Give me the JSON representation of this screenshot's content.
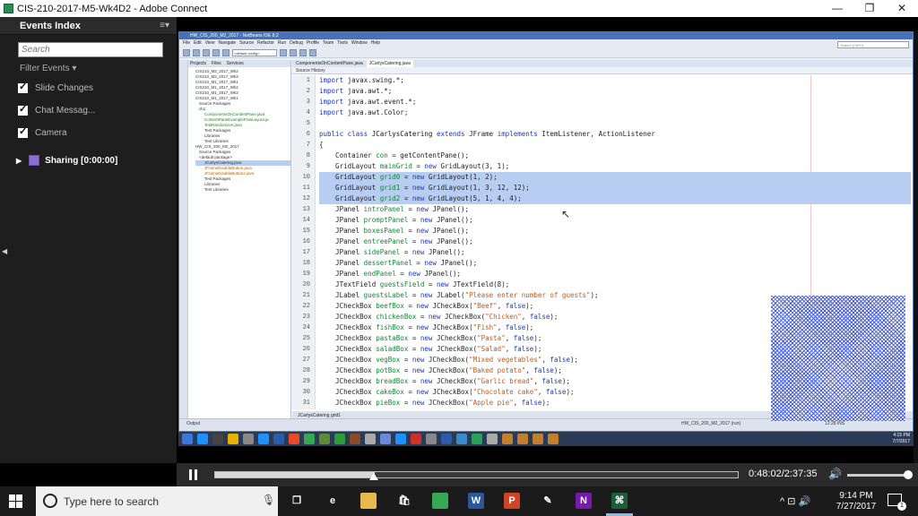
{
  "window": {
    "title": "CIS-210-2017-M5-Wk4D2 - Adobe Connect",
    "controls": [
      "—",
      "❐",
      "✕"
    ]
  },
  "sidebar": {
    "title": "Events Index",
    "menu_glyph": "≡▾",
    "search_placeholder": "Search",
    "filter_label": "Filter Events ▾",
    "items": [
      {
        "label": "Slide Changes"
      },
      {
        "label": "Chat Messag..."
      },
      {
        "label": "Camera"
      }
    ],
    "sharing_label": "Sharing [0:00:00]"
  },
  "netbeans": {
    "title": "HW_CIS_200_M2_2017 - NetBeans IDE 8.2",
    "menus": [
      "File",
      "Edit",
      "View",
      "Navigate",
      "Source",
      "Refactor",
      "Run",
      "Debug",
      "Profile",
      "Team",
      "Tools",
      "Window",
      "Help"
    ],
    "config": "<default config>",
    "search_placeholder": "Search (Ctrl+I)",
    "project_tabs": [
      "Projects",
      "Files",
      "Services"
    ],
    "tree": [
      {
        "text": "CIS210_M2_2017_Wk2",
        "cls": ""
      },
      {
        "text": "CIS210_M2_2017_Wk3",
        "cls": ""
      },
      {
        "text": "CIS210_M1_2017_Wk1",
        "cls": ""
      },
      {
        "text": "CIS210_M1_2017_Wk2",
        "cls": ""
      },
      {
        "text": "CIS210_M1_2017_Wk3",
        "cls": ""
      },
      {
        "text": "CIS210_M1_2017_Wk1",
        "cls": ""
      },
      {
        "text": "Source Packages",
        "cls": ""
      },
      {
        "text": "ch1",
        "cls": ""
      },
      {
        "text": "ComponentsOnContentPane.java",
        "cls": "g"
      },
      {
        "text": "ContentPaneExampleFlowLayout.ja",
        "cls": "g"
      },
      {
        "text": "TestRandomizer.java",
        "cls": "g"
      },
      {
        "text": "Test Packages",
        "cls": ""
      },
      {
        "text": "Libraries",
        "cls": ""
      },
      {
        "text": "Test Libraries",
        "cls": ""
      },
      {
        "text": "HW_CIS_200_M2_2017",
        "cls": ""
      },
      {
        "text": "Source Packages",
        "cls": ""
      },
      {
        "text": "<default package>",
        "cls": ""
      },
      {
        "text": "JCarlysCatering.java",
        "cls": "hl"
      },
      {
        "text": "JFrameDisableButton.java",
        "cls": "o"
      },
      {
        "text": "JFrameDisableButton2.java",
        "cls": "o"
      },
      {
        "text": "Test Packages",
        "cls": ""
      },
      {
        "text": "Libraries",
        "cls": ""
      },
      {
        "text": "Test Libraries",
        "cls": ""
      }
    ],
    "editor_tabs": [
      "ComponentsOnContentPane.java",
      "JCarlysCatering.java"
    ],
    "editor_toolbar": "Source  History",
    "footer_tabs": "JCarlysCatering  grid1",
    "status_output": "Output",
    "status_right": "HW_CIS_200_M2_2017 (run)",
    "status_pos": "12:28  INS",
    "code_lines": [
      {
        "n": "1",
        "sel": false,
        "parts": [
          [
            "kw",
            "import "
          ],
          [
            "",
            "javax.swing.*;"
          ]
        ]
      },
      {
        "n": "2",
        "sel": false,
        "parts": [
          [
            "kw",
            "import "
          ],
          [
            "",
            "java.awt.*;"
          ]
        ]
      },
      {
        "n": "3",
        "sel": false,
        "parts": [
          [
            "kw",
            "import "
          ],
          [
            "",
            "java.awt.event.*;"
          ]
        ]
      },
      {
        "n": "4",
        "sel": false,
        "parts": [
          [
            "kw",
            "import "
          ],
          [
            "",
            "java.awt.Color;"
          ]
        ]
      },
      {
        "n": "5",
        "sel": false,
        "parts": [
          [
            "",
            ""
          ]
        ]
      },
      {
        "n": "6",
        "sel": false,
        "parts": [
          [
            "kw",
            "public class "
          ],
          [
            "ty",
            "JCarlysCatering "
          ],
          [
            "kw",
            "extends "
          ],
          [
            "",
            "JFrame "
          ],
          [
            "kw",
            "implements "
          ],
          [
            "",
            "ItemListener, ActionListener"
          ]
        ]
      },
      {
        "n": "7",
        "sel": false,
        "parts": [
          [
            "",
            "{"
          ]
        ]
      },
      {
        "n": "8",
        "sel": false,
        "parts": [
          [
            "",
            "    Container "
          ],
          [
            "fld",
            "con"
          ],
          [
            "",
            " = getContentPane();"
          ]
        ]
      },
      {
        "n": "9",
        "sel": false,
        "parts": [
          [
            "",
            "    GridLayout "
          ],
          [
            "fld",
            "mainGrid"
          ],
          [
            "",
            " = "
          ],
          [
            "kw",
            "new "
          ],
          [
            "",
            "GridLayout(3, 1);"
          ]
        ]
      },
      {
        "n": "10",
        "sel": true,
        "parts": [
          [
            "",
            "    GridLayout "
          ],
          [
            "fld",
            "grid0"
          ],
          [
            "",
            " = "
          ],
          [
            "kw",
            "new "
          ],
          [
            "",
            "GridLayout(1, 2);"
          ]
        ]
      },
      {
        "n": "11",
        "sel": true,
        "parts": [
          [
            "",
            "    GridLayout "
          ],
          [
            "fld",
            "grid1"
          ],
          [
            "",
            " = "
          ],
          [
            "kw",
            "new "
          ],
          [
            "",
            "GridLayout(1, 3, 12, 12);"
          ]
        ]
      },
      {
        "n": "12",
        "sel": true,
        "parts": [
          [
            "",
            "    GridLayout "
          ],
          [
            "fld",
            "grid2"
          ],
          [
            "",
            " = "
          ],
          [
            "kw",
            "new "
          ],
          [
            "",
            "GridLayout(5, 1, 4, 4);"
          ]
        ]
      },
      {
        "n": "13",
        "sel": false,
        "parts": [
          [
            "",
            "    JPanel "
          ],
          [
            "fld",
            "introPanel"
          ],
          [
            "",
            " = "
          ],
          [
            "kw",
            "new "
          ],
          [
            "",
            "JPanel();"
          ]
        ]
      },
      {
        "n": "14",
        "sel": false,
        "parts": [
          [
            "",
            "    JPanel "
          ],
          [
            "fld",
            "promptPanel"
          ],
          [
            "",
            " = "
          ],
          [
            "kw",
            "new "
          ],
          [
            "",
            "JPanel();"
          ]
        ]
      },
      {
        "n": "15",
        "sel": false,
        "parts": [
          [
            "",
            "    JPanel "
          ],
          [
            "fld",
            "boxesPanel"
          ],
          [
            "",
            " = "
          ],
          [
            "kw",
            "new "
          ],
          [
            "",
            "JPanel();"
          ]
        ]
      },
      {
        "n": "16",
        "sel": false,
        "parts": [
          [
            "",
            "    JPanel "
          ],
          [
            "fld",
            "entreePanel"
          ],
          [
            "",
            " = "
          ],
          [
            "kw",
            "new "
          ],
          [
            "",
            "JPanel();"
          ]
        ]
      },
      {
        "n": "17",
        "sel": false,
        "parts": [
          [
            "",
            "    JPanel "
          ],
          [
            "fld",
            "sidePanel"
          ],
          [
            "",
            " = "
          ],
          [
            "kw",
            "new "
          ],
          [
            "",
            "JPanel();"
          ]
        ]
      },
      {
        "n": "18",
        "sel": false,
        "parts": [
          [
            "",
            "    JPanel "
          ],
          [
            "fld",
            "dessertPanel"
          ],
          [
            "",
            " = "
          ],
          [
            "kw",
            "new "
          ],
          [
            "",
            "JPanel();"
          ]
        ]
      },
      {
        "n": "19",
        "sel": false,
        "parts": [
          [
            "",
            "    JPanel "
          ],
          [
            "fld",
            "endPanel"
          ],
          [
            "",
            " = "
          ],
          [
            "kw",
            "new "
          ],
          [
            "",
            "JPanel();"
          ]
        ]
      },
      {
        "n": "20",
        "sel": false,
        "parts": [
          [
            "",
            "    JTextField "
          ],
          [
            "fld",
            "guestsField"
          ],
          [
            "",
            " = "
          ],
          [
            "kw",
            "new "
          ],
          [
            "",
            "JTextField(8);"
          ]
        ]
      },
      {
        "n": "21",
        "sel": false,
        "parts": [
          [
            "",
            "    JLabel "
          ],
          [
            "fld",
            "guestsLabel"
          ],
          [
            "",
            " = "
          ],
          [
            "kw",
            "new "
          ],
          [
            "",
            "JLabel("
          ],
          [
            "str",
            "\"Please enter number of guests\""
          ],
          [
            "",
            ");"
          ]
        ]
      },
      {
        "n": "22",
        "sel": false,
        "parts": [
          [
            "",
            "    JCheckBox "
          ],
          [
            "fld",
            "beefBox"
          ],
          [
            "",
            " = "
          ],
          [
            "kw",
            "new "
          ],
          [
            "",
            "JCheckBox("
          ],
          [
            "str",
            "\"Beef\""
          ],
          [
            "",
            ", "
          ],
          [
            "kw",
            "false"
          ],
          [
            "",
            ");"
          ]
        ]
      },
      {
        "n": "23",
        "sel": false,
        "parts": [
          [
            "",
            "    JCheckBox "
          ],
          [
            "fld",
            "chickenBox"
          ],
          [
            "",
            " = "
          ],
          [
            "kw",
            "new "
          ],
          [
            "",
            "JCheckBox("
          ],
          [
            "str",
            "\"Chicken\""
          ],
          [
            "",
            ", "
          ],
          [
            "kw",
            "false"
          ],
          [
            "",
            ");"
          ]
        ]
      },
      {
        "n": "24",
        "sel": false,
        "parts": [
          [
            "",
            "    JCheckBox "
          ],
          [
            "fld",
            "fishBox"
          ],
          [
            "",
            " = "
          ],
          [
            "kw",
            "new "
          ],
          [
            "",
            "JCheckBox("
          ],
          [
            "str",
            "\"Fish\""
          ],
          [
            "",
            ", "
          ],
          [
            "kw",
            "false"
          ],
          [
            "",
            ");"
          ]
        ]
      },
      {
        "n": "25",
        "sel": false,
        "parts": [
          [
            "",
            "    JCheckBox "
          ],
          [
            "fld",
            "pastaBox"
          ],
          [
            "",
            " = "
          ],
          [
            "kw",
            "new "
          ],
          [
            "",
            "JCheckBox("
          ],
          [
            "str",
            "\"Pasta\""
          ],
          [
            "",
            ", "
          ],
          [
            "kw",
            "false"
          ],
          [
            "",
            ");"
          ]
        ]
      },
      {
        "n": "26",
        "sel": false,
        "parts": [
          [
            "",
            "    JCheckBox "
          ],
          [
            "fld",
            "saladBox"
          ],
          [
            "",
            " = "
          ],
          [
            "kw",
            "new "
          ],
          [
            "",
            "JCheckBox("
          ],
          [
            "str",
            "\"Salad\""
          ],
          [
            "",
            ", "
          ],
          [
            "kw",
            "false"
          ],
          [
            "",
            ");"
          ]
        ]
      },
      {
        "n": "27",
        "sel": false,
        "parts": [
          [
            "",
            "    JCheckBox "
          ],
          [
            "fld",
            "vegBox"
          ],
          [
            "",
            " = "
          ],
          [
            "kw",
            "new "
          ],
          [
            "",
            "JCheckBox("
          ],
          [
            "str",
            "\"Mixed vegetables\""
          ],
          [
            "",
            ", "
          ],
          [
            "kw",
            "false"
          ],
          [
            "",
            ");"
          ]
        ]
      },
      {
        "n": "28",
        "sel": false,
        "parts": [
          [
            "",
            "    JCheckBox "
          ],
          [
            "fld",
            "potBox"
          ],
          [
            "",
            " = "
          ],
          [
            "kw",
            "new "
          ],
          [
            "",
            "JCheckBox("
          ],
          [
            "str",
            "\"Baked potato\""
          ],
          [
            "",
            ", "
          ],
          [
            "kw",
            "false"
          ],
          [
            "",
            ");"
          ]
        ]
      },
      {
        "n": "29",
        "sel": false,
        "parts": [
          [
            "",
            "    JCheckBox "
          ],
          [
            "fld",
            "breadBox"
          ],
          [
            "",
            " = "
          ],
          [
            "kw",
            "new "
          ],
          [
            "",
            "JCheckBox("
          ],
          [
            "str",
            "\"Garlic bread\""
          ],
          [
            "",
            ", "
          ],
          [
            "kw",
            "false"
          ],
          [
            "",
            ");"
          ]
        ]
      },
      {
        "n": "30",
        "sel": false,
        "parts": [
          [
            "",
            "    JCheckBox "
          ],
          [
            "fld",
            "cakeBox"
          ],
          [
            "",
            " = "
          ],
          [
            "kw",
            "new "
          ],
          [
            "",
            "JCheckBox("
          ],
          [
            "str",
            "\"Chocolate cake\""
          ],
          [
            "",
            ", "
          ],
          [
            "kw",
            "false"
          ],
          [
            "",
            ");"
          ]
        ]
      },
      {
        "n": "31",
        "sel": false,
        "parts": [
          [
            "",
            "    JCheckBox "
          ],
          [
            "fld",
            "pieBox"
          ],
          [
            "",
            " = "
          ],
          [
            "kw",
            "new "
          ],
          [
            "",
            "JCheckBox("
          ],
          [
            "str",
            "\"Apple pie\""
          ],
          [
            "",
            ", "
          ],
          [
            "kw",
            "false"
          ],
          [
            "",
            ");"
          ]
        ]
      }
    ]
  },
  "recorded_taskbar": {
    "clock_time": "4:15 PM",
    "clock_date": "7/7/2017",
    "icons": [
      "#3b78d8",
      "#1e90ff",
      "#444",
      "#e8b000",
      "#888",
      "#1e90ff",
      "#2a5caa",
      "#e84a2a",
      "#34a853",
      "#5a8a3a",
      "#2a9d3a",
      "#8a4a2a",
      "#aaa",
      "#6a8ad8",
      "#1e90ff",
      "#d0302a",
      "#888",
      "#2a5caa",
      "#3a8aca",
      "#2aa05a",
      "#aaa",
      "#c08030",
      "#c08030",
      "#c08030",
      "#c08030"
    ]
  },
  "player": {
    "time": "0:48:02/2:37:35",
    "progress": 0.3046,
    "volume": 1.0,
    "volume_icon": "🔊"
  },
  "taskbar": {
    "search_placeholder": "Type here to search",
    "mic_icon": "🎙",
    "apps": [
      {
        "name": "task-view-icon",
        "glyph": "❐",
        "color": "#1b1b1b"
      },
      {
        "name": "edge-icon",
        "glyph": "e",
        "color": "#1b1b1b"
      },
      {
        "name": "file-explorer-icon",
        "glyph": "",
        "color": "#e8b84a"
      },
      {
        "name": "store-icon",
        "glyph": "🛍",
        "color": "#1b1b1b"
      },
      {
        "name": "chrome-icon",
        "glyph": "",
        "color": "#34a853"
      },
      {
        "name": "word-icon",
        "glyph": "W",
        "color": "#2b579a"
      },
      {
        "name": "powerpoint-icon",
        "glyph": "P",
        "color": "#d04423"
      },
      {
        "name": "pen-app-icon",
        "glyph": "✎",
        "color": "#1b1b1b"
      },
      {
        "name": "onenote-icon",
        "glyph": "N",
        "color": "#7719aa"
      },
      {
        "name": "adobe-connect-icon",
        "glyph": "⌘",
        "color": "#1b5e38"
      }
    ],
    "tray_icons": "^  ⊡  🔊",
    "time": "9:14 PM",
    "date": "7/27/2017"
  },
  "colors": {
    "selection": "#b7cdf1",
    "keyword": "#1a37c4",
    "string": "#c25a1a",
    "field": "#0a8a2e"
  }
}
